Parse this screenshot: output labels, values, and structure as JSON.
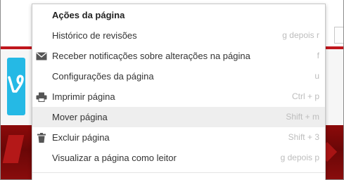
{
  "menu": {
    "header": "Ações da página",
    "items": [
      {
        "label": "Histórico de revisões",
        "shortcut": "g depois r",
        "icon": null
      },
      {
        "label": "Receber notificações sobre alterações na página",
        "shortcut": "f",
        "icon": "envelope-icon"
      },
      {
        "label": "Configurações da página",
        "shortcut": "u",
        "icon": null
      },
      {
        "label": "Imprimir página",
        "shortcut": "Ctrl + p",
        "icon": "printer-icon"
      },
      {
        "label": "Mover página",
        "shortcut": "Shift + m",
        "icon": null,
        "highlighted": true
      },
      {
        "label": "Excluir página",
        "shortcut": "Shift + 3",
        "icon": "trash-icon"
      },
      {
        "label": "Visualizar a página como leitor",
        "shortcut": "g depois p",
        "icon": null
      }
    ]
  },
  "colors": {
    "highlight": "#eeeeee",
    "shortcut_text": "#bdbdbd",
    "icon": "#555555",
    "background_red": "#c0161d",
    "logo_blue": "#25b9e5"
  }
}
